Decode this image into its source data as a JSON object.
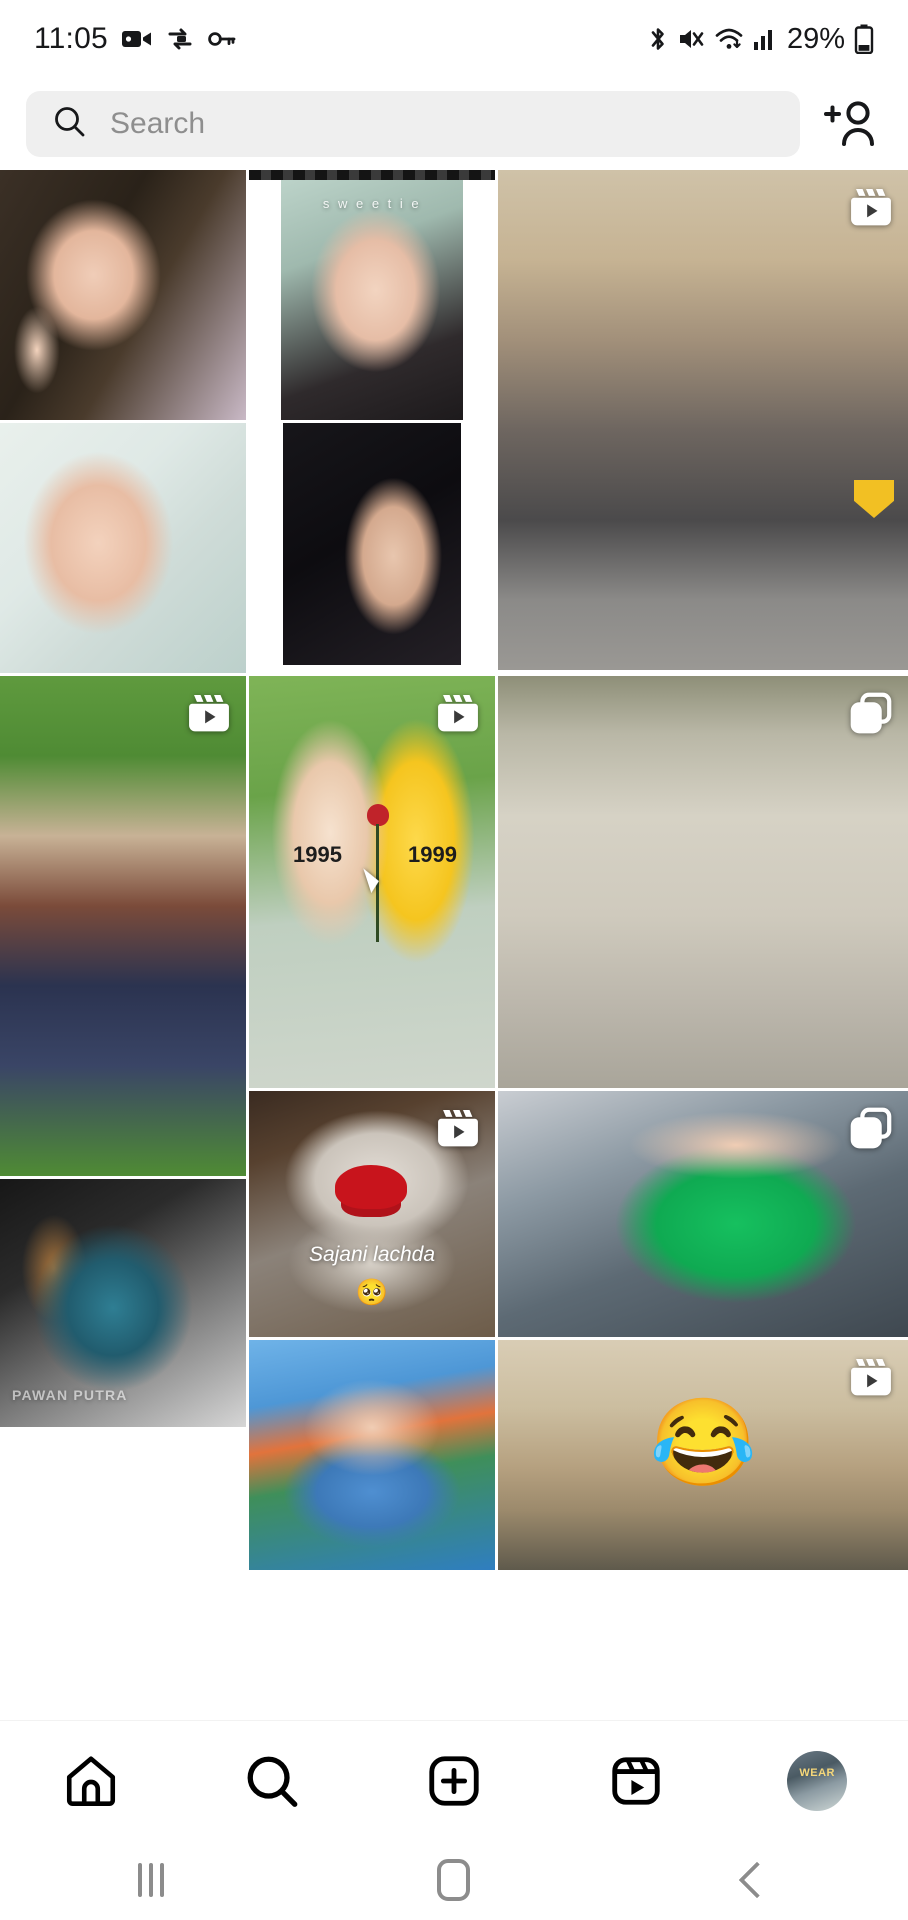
{
  "status_bar": {
    "time": "11:05",
    "battery_percent": "29%",
    "left_icons": [
      "video-camera-icon",
      "sync-icon",
      "vpn-key-icon"
    ],
    "right_icons": [
      "bluetooth-icon",
      "mute-icon",
      "wifi-icon",
      "cellular-signal-icon",
      "battery-icon"
    ]
  },
  "header": {
    "search_placeholder": "Search",
    "search_value": "",
    "search_icon": "search-icon",
    "add_person_icon": "add-person-icon"
  },
  "grid": {
    "tiles": [
      {
        "id": "t1",
        "col": 1,
        "row": 1,
        "span": 1,
        "media_type": "photo",
        "badge": "none",
        "caption": ""
      },
      {
        "id": "t2",
        "col": 2,
        "row": 1,
        "span": 1,
        "media_type": "photo",
        "badge": "none",
        "caption": "sweetie"
      },
      {
        "id": "t3",
        "col": 3,
        "row": 1,
        "span": 2,
        "media_type": "reel",
        "badge": "reel-icon",
        "caption": ""
      },
      {
        "id": "t4",
        "col": 1,
        "row": 2,
        "span": 1,
        "media_type": "photo",
        "badge": "none",
        "caption": ""
      },
      {
        "id": "t5",
        "col": 2,
        "row": 2,
        "span": 1,
        "media_type": "photo",
        "badge": "none",
        "caption": ""
      },
      {
        "id": "t6",
        "col": 1,
        "row": 3,
        "span": 2,
        "media_type": "reel",
        "badge": "reel-icon",
        "caption": ""
      },
      {
        "id": "t7",
        "col": 2,
        "row": 3,
        "span": 1,
        "media_type": "reel",
        "badge": "reel-icon",
        "caption": "1995 / 1999"
      },
      {
        "id": "t8",
        "col": 3,
        "row": 3,
        "span": 1,
        "media_type": "carousel",
        "badge": "carousel-icon",
        "caption": ""
      },
      {
        "id": "t9",
        "col": 2,
        "row": 4,
        "span": 1,
        "media_type": "reel",
        "badge": "reel-icon",
        "caption": "Sajani lachda"
      },
      {
        "id": "t10",
        "col": 3,
        "row": 4,
        "span": 1,
        "media_type": "carousel",
        "badge": "carousel-icon",
        "caption": ""
      },
      {
        "id": "t11",
        "col": 1,
        "row": 5,
        "span": 1,
        "media_type": "photo",
        "badge": "none",
        "caption": "PAWAN PUTRA"
      },
      {
        "id": "t12",
        "col": 2,
        "row": 5,
        "span": 1,
        "media_type": "photo",
        "badge": "none",
        "caption": ""
      },
      {
        "id": "t13",
        "col": 3,
        "row": 5,
        "span": 1,
        "media_type": "reel",
        "badge": "reel-icon",
        "caption": ""
      }
    ],
    "overlay_text": {
      "sweetie": "s w e e t i e",
      "hoodie_left": "1995",
      "hoodie_right": "1999",
      "teddy_caption": "Sajani lachda",
      "teddy_emoji": "🥺",
      "watermark": "PAWAN PUTRA",
      "desert_emoji": "😂"
    }
  },
  "bottom_nav": {
    "items": [
      {
        "name": "home",
        "icon": "home-icon",
        "active": false
      },
      {
        "name": "search",
        "icon": "search-icon",
        "active": true
      },
      {
        "name": "create",
        "icon": "plus-box-icon",
        "active": false
      },
      {
        "name": "reels",
        "icon": "reels-icon",
        "active": false
      },
      {
        "name": "profile",
        "icon": "avatar-icon",
        "active": false
      }
    ],
    "avatar_label": "WEAR"
  },
  "system_nav": {
    "recents_icon": "recents-icon",
    "home_icon": "home-square-icon",
    "back_icon": "back-chevron-icon"
  },
  "colors": {
    "background": "#ffffff",
    "search_field": "#efefef",
    "placeholder_text": "#8e8e8e",
    "primary_text": "#17181a",
    "system_nav_icon": "#8c8c8c"
  }
}
